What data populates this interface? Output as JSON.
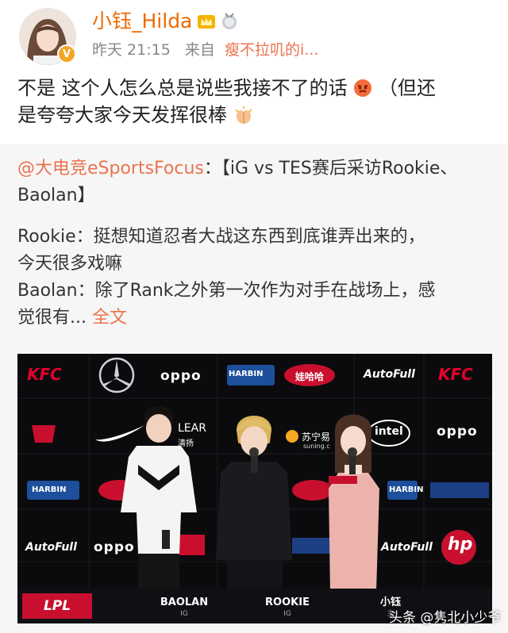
{
  "post": {
    "username": "小钰_Hilda",
    "avatar_badge": "V",
    "time": "昨天 21:15",
    "source_prefix": "来自",
    "source": "瘦不拉叽的i...",
    "text_line1": "不是 这个人怎么总是说些我接不了的话",
    "text_line1_tail": " （但还",
    "text_line2": "是夸夸大家今天发挥很棒"
  },
  "repost": {
    "mention": "@大电竞eSportsFocus",
    "title_rest": "：【iG vs TES赛后采访Rookie、",
    "title_line2": "Baolan】",
    "rookie_line1": "Rookie：挺想知道忍者大战这东西到底谁弄出来的，",
    "rookie_line2": "今天很多戏嘛",
    "baolan_line1": "Baolan：除了Rank之外第一次作为对手在战场上，感",
    "baolan_line2": "觉很有...",
    "full_text_link": "全文"
  },
  "image": {
    "kfc": "KFC",
    "oppo": "oppo",
    "autofull": "AutoFull",
    "lpl": "LPL",
    "clear": "LEAR",
    "clear_cn": "清扬",
    "suning": "苏宁易",
    "suning_en": "suning.c",
    "intel": "intel",
    "harbin": "HARBIN",
    "wahaha": "娃哈哈",
    "hp": "hp",
    "nameplates": [
      {
        "name": "BAOLAN",
        "team": "IG"
      },
      {
        "name": "ROOKIE",
        "team": "IG"
      },
      {
        "name": "小钰",
        "team": "主"
      }
    ]
  },
  "watermark": "头条 @隽北小少爷",
  "colors": {
    "username": "#ef6a00",
    "link": "#eb7350",
    "repost_bg": "#f6f6f6",
    "stage_bg": "#0b0b0d",
    "kfc_red": "#e4002b"
  }
}
